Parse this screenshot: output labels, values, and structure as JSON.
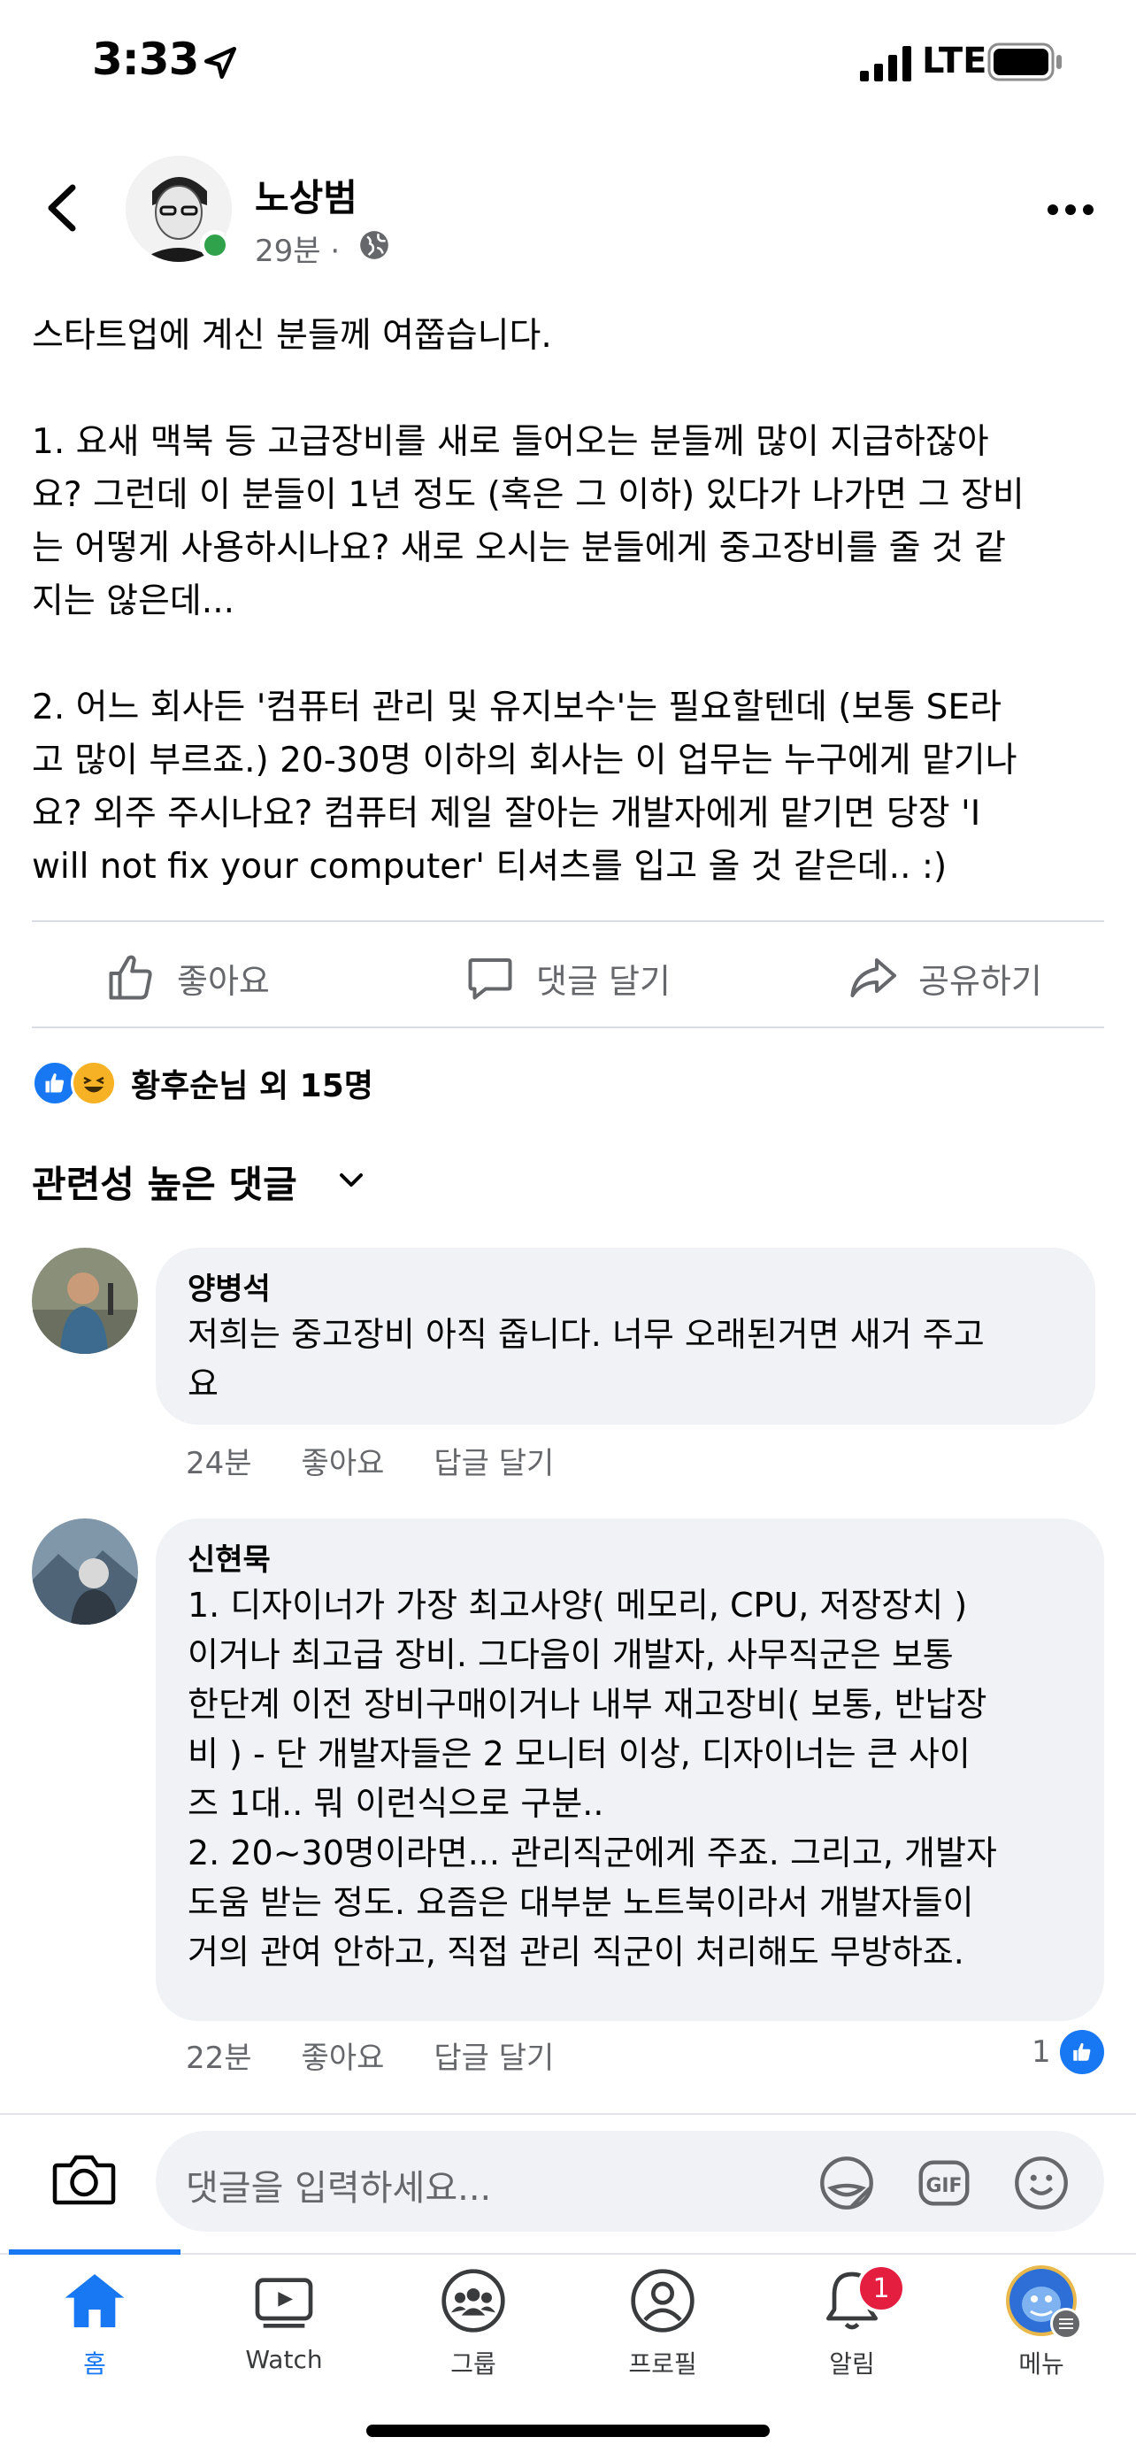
{
  "status_bar": {
    "time": "3:33",
    "network": "LTE"
  },
  "post": {
    "author": "노상범",
    "time": "29분",
    "separator": "·",
    "body": "스타트업에 계신 분들께 여쭙습니다.\n\n1. 요새 맥북 등 고급장비를 새로 들어오는 분들께 많이 지급하잖아\n요? 그런데 이 분들이 1년 정도 (혹은 그 이하) 있다가 나가면 그 장비\n는 어떻게 사용하시나요? 새로 오시는 분들에게 중고장비를 줄 것 같\n지는 않은데...\n\n2. 어느 회사든 '컴퓨터 관리 및 유지보수'는 필요할텐데 (보통 SE라\n고 많이 부르죠.) 20-30명 이하의 회사는 이 업무는 누구에게 맡기나\n요? 외주 주시나요? 컴퓨터 제일 잘아는 개발자에게 맡기면 당장 'I\nwill not fix your computer' 티셔츠를 입고 올 것 같은데.. :)"
  },
  "actions": {
    "like": "좋아요",
    "comment": "댓글 달기",
    "share": "공유하기"
  },
  "reactions": {
    "summary": "황후순님 외 15명"
  },
  "comments_sort": {
    "label": "관련성 높은 댓글"
  },
  "comments": [
    {
      "name": "양병석",
      "text": "저희는 중고장비 아직 줍니다. 너무 오래된거면 새거 주고\n요",
      "time": "24분",
      "like": "좋아요",
      "reply": "답글 달기"
    },
    {
      "name": "신현묵",
      "text": "1. 디자이너가 가장 최고사양( 메모리, CPU, 저장장치 )\n이거나 최고급 장비. 그다음이 개발자, 사무직군은 보통\n한단계 이전 장비구매이거나 내부 재고장비( 보통, 반납장\n비 ) - 단 개발자들은 2 모니터 이상, 디자이너는 큰 사이\n즈 1대.. 뭐 이런식으로 구분..\n2. 20~30명이라면... 관리직군에게 주죠. 그리고, 개발자\n도움 받는 정도. 요즘은 대부분 노트북이라서 개발자들이\n거의 관여 안하고, 직접 관리 직군이 처리해도 무방하죠.",
      "time": "22분",
      "like": "좋아요",
      "reply": "답글 달기",
      "like_count": "1"
    }
  ],
  "comment_input": {
    "placeholder": "댓글을 입력하세요..."
  },
  "tabs": [
    {
      "label": "홈",
      "icon": "home-icon",
      "active": true
    },
    {
      "label": "Watch",
      "icon": "watch-icon"
    },
    {
      "label": "그룹",
      "icon": "groups-icon"
    },
    {
      "label": "프로필",
      "icon": "profile-icon"
    },
    {
      "label": "알림",
      "icon": "bell-icon",
      "badge": "1"
    },
    {
      "label": "메뉴",
      "icon": "menu-avatar-icon"
    }
  ],
  "colors": {
    "accent": "#1877f2",
    "bubble": "#f0f2f5",
    "secondary_text": "#65676b",
    "badge": "#e41e3f",
    "online": "#31a24c"
  }
}
